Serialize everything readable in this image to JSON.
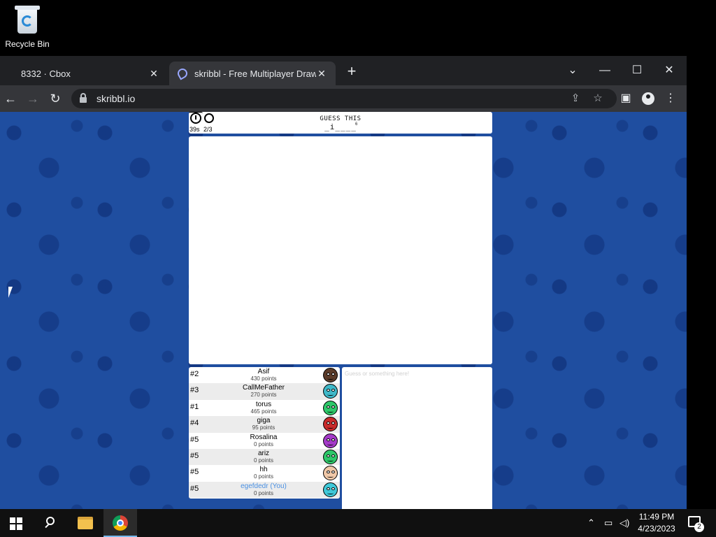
{
  "desktop": {
    "recycle_bin_label": "Recycle Bin"
  },
  "browser": {
    "tabs": [
      {
        "title": "8332 · Cbox",
        "active": false
      },
      {
        "title": "skribbl - Free Multiplayer Drawing",
        "active": true
      }
    ],
    "address": "skribbl.io",
    "icons": {
      "back": "←",
      "forward": "→",
      "reload": "↻",
      "share": "⇪",
      "star": "☆",
      "sidepanel": "▣",
      "menu": "⋮",
      "newtab": "+",
      "close": "✕",
      "tabsearch": "⌄",
      "minimize": "—",
      "maximize": "☐"
    }
  },
  "game": {
    "timer": "39s",
    "round": "2/3",
    "guess_label": "GUESS THIS",
    "word_hint": "_i____",
    "word_count": "6",
    "chat_placeholder": "Guess or something here!",
    "players": [
      {
        "rank": "#2",
        "name": "Asif",
        "points": "430 points",
        "color": "#5a3a28",
        "you": false
      },
      {
        "rank": "#3",
        "name": "CallMeFather",
        "points": "270 points",
        "color": "#3fb8c8",
        "you": false
      },
      {
        "rank": "#1",
        "name": "torus",
        "points": "465 points",
        "color": "#2ec86a",
        "you": false
      },
      {
        "rank": "#4",
        "name": "giga",
        "points": "95 points",
        "color": "#c82a2a",
        "you": false
      },
      {
        "rank": "#5",
        "name": "Rosalina",
        "points": "0 points",
        "color": "#a43ac8",
        "you": false
      },
      {
        "rank": "#5",
        "name": "ariz",
        "points": "0 points",
        "color": "#2ec86a",
        "you": false
      },
      {
        "rank": "#5",
        "name": "hh",
        "points": "0 points",
        "color": "#f0c8a8",
        "you": false
      },
      {
        "rank": "#5",
        "name": "egefdedr (You)",
        "points": "0 points",
        "color": "#3fc8d8",
        "you": true
      }
    ]
  },
  "taskbar": {
    "time": "11:49 PM",
    "date": "4/23/2023",
    "notification_count": "2"
  }
}
